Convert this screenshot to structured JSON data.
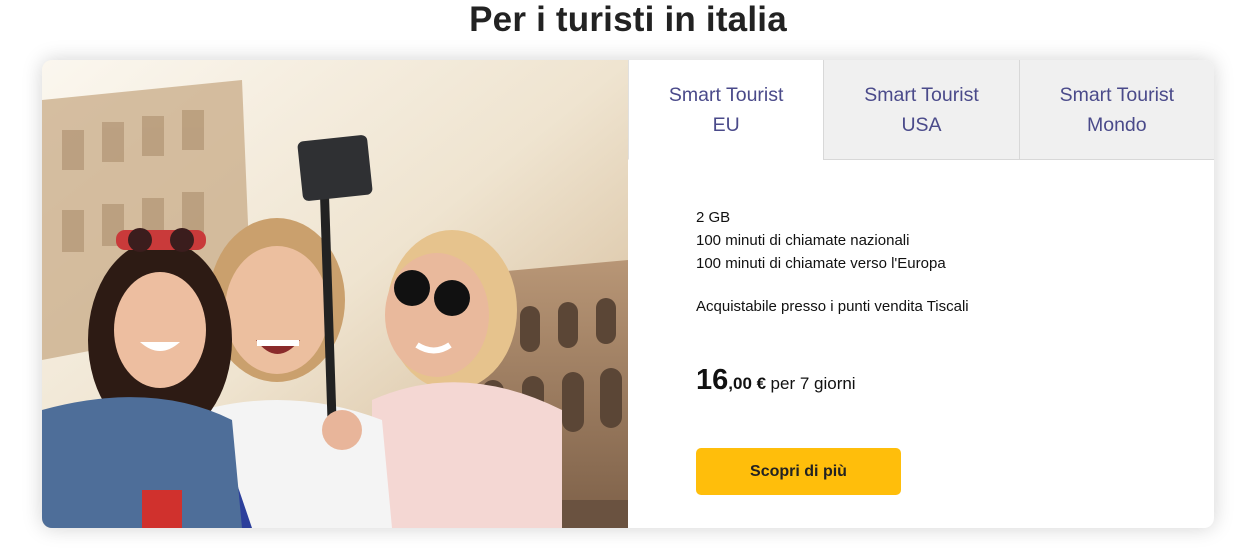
{
  "title": "Per i turisti in italia",
  "tabs": [
    {
      "label": "Smart Tourist\nEU",
      "active": true
    },
    {
      "label": "Smart Tourist\nUSA",
      "active": false
    },
    {
      "label": "Smart Tourist\nMondo",
      "active": false
    }
  ],
  "offer": {
    "features": [
      "2 GB",
      "100 minuti di chiamate nazionali",
      "100 minuti di chiamate verso l'Europa"
    ],
    "availability": "Acquistabile presso i punti vendita Tiscali",
    "price_int": "16",
    "price_dec": ",00 €",
    "price_period": "per 7 giorni",
    "cta_label": "Scopri di più"
  },
  "colors": {
    "accent": "#ffbe0b",
    "tab_text": "#4a4a8a",
    "tab_inactive_bg": "#f0f0f0"
  }
}
